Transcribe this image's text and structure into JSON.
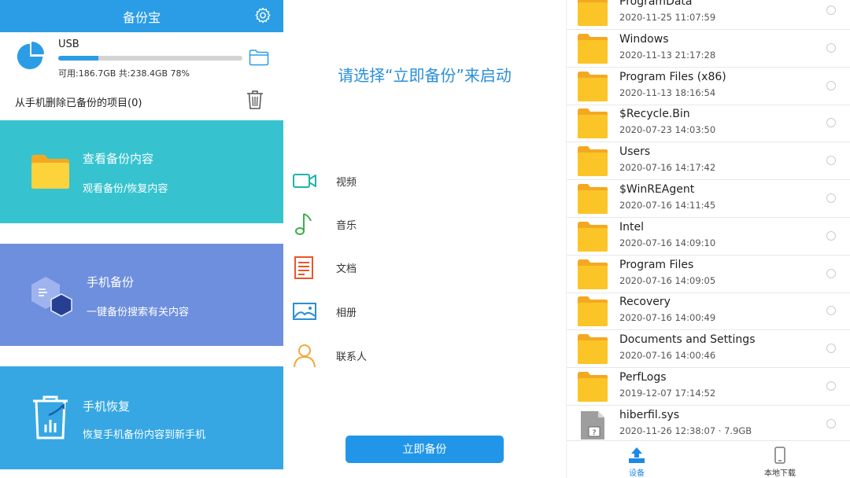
{
  "panel1": {
    "header_title": "备份宝",
    "usb": {
      "name": "USB",
      "info": "可用:186.7GB 共:238.4GB  78%",
      "used_fraction": 0.22
    },
    "delete_backed_up": "从手机删除已备份的项目(0)",
    "cards": [
      {
        "title": "查看备份内容",
        "sub": "观看备份/恢复内容"
      },
      {
        "title": "手机备份",
        "sub": "一键备份搜索有关内容"
      },
      {
        "title": "手机恢复",
        "sub": "恢复手机备份内容到新手机"
      }
    ]
  },
  "panel2": {
    "prompt": "请选择“立即备份”来启动",
    "categories": [
      {
        "label": "视频",
        "icon": "video-icon"
      },
      {
        "label": "音乐",
        "icon": "music-icon"
      },
      {
        "label": "文档",
        "icon": "document-icon"
      },
      {
        "label": "相册",
        "icon": "photo-icon"
      },
      {
        "label": "联系人",
        "icon": "contacts-icon"
      }
    ],
    "backup_button": "立即备份"
  },
  "panel3": {
    "files": [
      {
        "name": "ProgramData",
        "date": "2020-11-25 11:07:59",
        "type": "folder"
      },
      {
        "name": "Windows",
        "date": "2020-11-13 21:17:28",
        "type": "folder"
      },
      {
        "name": "Program Files (x86)",
        "date": "2020-11-13 18:16:54",
        "type": "folder"
      },
      {
        "name": "$Recycle.Bin",
        "date": "2020-07-23 14:03:50",
        "type": "folder"
      },
      {
        "name": "Users",
        "date": "2020-07-16 14:17:42",
        "type": "folder"
      },
      {
        "name": "$WinREAgent",
        "date": "2020-07-16 14:11:45",
        "type": "folder"
      },
      {
        "name": "Intel",
        "date": "2020-07-16 14:09:10",
        "type": "folder"
      },
      {
        "name": "Program Files",
        "date": "2020-07-16 14:09:05",
        "type": "folder"
      },
      {
        "name": "Recovery",
        "date": "2020-07-16 14:00:49",
        "type": "folder"
      },
      {
        "name": "Documents and Settings",
        "date": "2020-07-16 14:00:46",
        "type": "folder"
      },
      {
        "name": "PerfLogs",
        "date": "2019-12-07 17:14:52",
        "type": "folder"
      },
      {
        "name": "hiberfil.sys",
        "date": "2020-11-26 12:38:07 · 7.9GB",
        "type": "file"
      }
    ],
    "nav": [
      {
        "label": "设备",
        "active": true
      },
      {
        "label": "本地下载",
        "active": false
      }
    ]
  },
  "colors": {
    "header_blue": "#2a9de6",
    "card_teal": "#36c3cf",
    "card_periwinkle": "#6e8fdd",
    "card_sky": "#36a7e3",
    "folder_yellow": "#fbc527",
    "button_blue": "#2196e9"
  }
}
